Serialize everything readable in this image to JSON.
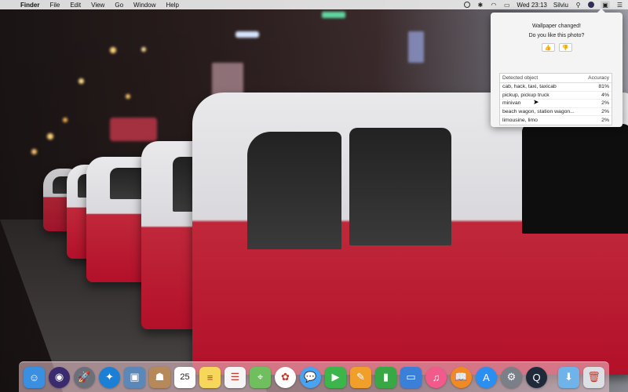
{
  "menubar": {
    "apple": "",
    "app_name": "Finder",
    "items": [
      "File",
      "Edit",
      "View",
      "Go",
      "Window",
      "Help"
    ],
    "clock": "Wed 23:13",
    "user": "Silviu"
  },
  "popover": {
    "title": "Wallpaper changed!",
    "question": "Do you like this photo?",
    "like_icon": "👍",
    "dislike_icon": "👎",
    "table_headers": [
      "Detected object",
      "Accuracy"
    ],
    "results": [
      {
        "object": "cab, hack, taxi, taxicab",
        "accuracy": "81%"
      },
      {
        "object": "pickup, pickup truck",
        "accuracy": "4%"
      },
      {
        "object": "minivan",
        "accuracy": "2%"
      },
      {
        "object": "beach wagon, station wagon...",
        "accuracy": "2%"
      },
      {
        "object": "limousine, limo",
        "accuracy": "2%"
      }
    ]
  },
  "dock": {
    "apps": [
      {
        "name": "finder-icon",
        "glyph": "☺",
        "color": "#3b8fe0"
      },
      {
        "name": "siri-icon",
        "glyph": "◉",
        "color": "#3a2a6e"
      },
      {
        "name": "launchpad-icon",
        "glyph": "🚀",
        "color": "#6b6f7a"
      },
      {
        "name": "safari-icon",
        "glyph": "✦",
        "color": "#1c7fd6"
      },
      {
        "name": "preview-icon",
        "glyph": "▣",
        "color": "#5b88b8"
      },
      {
        "name": "contacts-icon",
        "glyph": "☗",
        "color": "#b5895a"
      },
      {
        "name": "calendar-icon",
        "glyph": "25",
        "color": "#ffffff"
      },
      {
        "name": "notes-icon",
        "glyph": "≡",
        "color": "#f6d65b"
      },
      {
        "name": "reminders-icon",
        "glyph": "☰",
        "color": "#f5f5f5"
      },
      {
        "name": "maps-icon",
        "glyph": "⌖",
        "color": "#6fbf5e"
      },
      {
        "name": "photos-icon",
        "glyph": "✿",
        "color": "#ffffff"
      },
      {
        "name": "messages-icon",
        "glyph": "💬",
        "color": "#4aa3f0"
      },
      {
        "name": "facetime-icon",
        "glyph": "▶",
        "color": "#3cb54a"
      },
      {
        "name": "pages-icon",
        "glyph": "✎",
        "color": "#f0a02a"
      },
      {
        "name": "numbers-icon",
        "glyph": "▮",
        "color": "#38a844"
      },
      {
        "name": "keynote-icon",
        "glyph": "▭",
        "color": "#3a7fd8"
      },
      {
        "name": "itunes-icon",
        "glyph": "♫",
        "color": "#f15a8a"
      },
      {
        "name": "ibooks-icon",
        "glyph": "📖",
        "color": "#f08a24"
      },
      {
        "name": "app-store-icon",
        "glyph": "A",
        "color": "#2a8ff0"
      },
      {
        "name": "system-preferences-icon",
        "glyph": "⚙",
        "color": "#7a7f88"
      },
      {
        "name": "quicktime-icon",
        "glyph": "Q",
        "color": "#1e2a3a"
      }
    ],
    "folders": [
      {
        "name": "downloads-folder-icon",
        "glyph": "⬇",
        "color": "#6fb3e8"
      },
      {
        "name": "trash-icon",
        "glyph": "🗑",
        "color": "#dcdfe4"
      }
    ]
  }
}
